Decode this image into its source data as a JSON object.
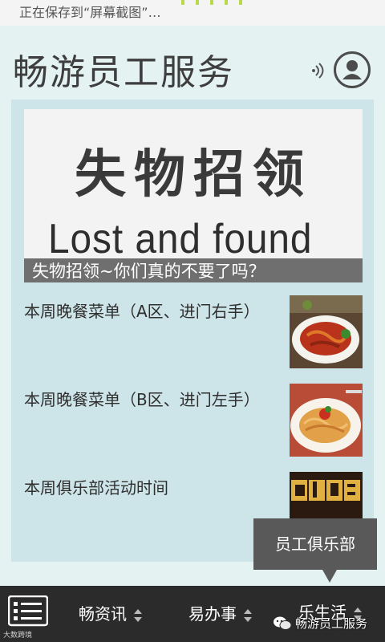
{
  "status_bar": {
    "text": "正在保存到“屏幕截图”…"
  },
  "header": {
    "title": "畅游员工服务",
    "profile_icon": "user-circle-icon",
    "voice_icon": "sound-waves-icon"
  },
  "banner": {
    "headline": "失物招领",
    "subhead": "Lost and found",
    "caption": "失物招领~你们真的不要了吗？"
  },
  "news": [
    {
      "title": "本周晚餐菜单（A区、进门右手）",
      "thumb": "pasta-dish-image"
    },
    {
      "title": "本周晚餐菜单（B区、进门左手）",
      "thumb": "spaghetti-dish-image"
    },
    {
      "title": "本周俱乐部活动时间",
      "thumb": "club-sign-image"
    }
  ],
  "tooltip": {
    "text": "员工俱乐部"
  },
  "nav": {
    "menu_icon": "list-menu-icon",
    "brand": "大数跨境",
    "tabs": [
      {
        "label": "畅资讯"
      },
      {
        "label": "易办事"
      },
      {
        "label": "乐生活"
      }
    ]
  },
  "watermark": {
    "text": "畅游员工服务"
  },
  "colors": {
    "background": "#e4f3f2",
    "panel": "#cde4e8",
    "nav": "#2b2b2b",
    "tooltip": "#595959"
  }
}
